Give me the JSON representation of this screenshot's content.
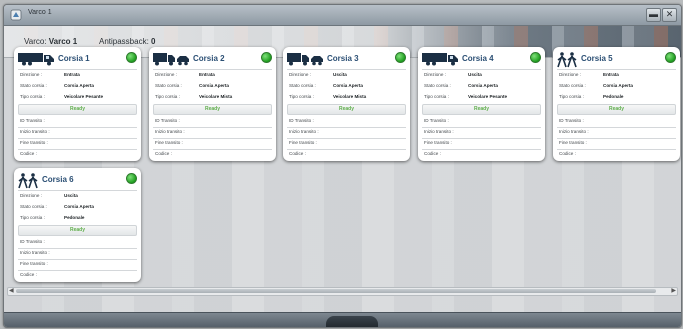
{
  "window": {
    "title": "Varco 1"
  },
  "header": {
    "varco_label": "Varco:",
    "varco_value": "Varco 1",
    "antipass_label": "Antipassback:",
    "antipass_value": "0"
  },
  "labels": {
    "direzione": "Direzione :",
    "stato": "Stato corsia :",
    "tipo": "Tipo corsia :",
    "id": "ID Transito :",
    "inizio": "Inizio transito :",
    "fine": "Fine transito :",
    "codice": "Codice :"
  },
  "lanes": [
    {
      "name": "Corsia 1",
      "icon": "truck-icon",
      "direzione": "Entrata",
      "stato": "Corsia Aperta",
      "tipo": "Veicolare Pesante",
      "status": "Ready",
      "led_color": "#1e9e1e"
    },
    {
      "name": "Corsia 2",
      "icon": "car-truck-icon",
      "direzione": "Entrata",
      "stato": "Corsia Aperta",
      "tipo": "Veicolare Mista",
      "status": "Ready",
      "led_color": "#1e9e1e"
    },
    {
      "name": "Corsia 3",
      "icon": "car-truck-icon",
      "direzione": "Uscita",
      "stato": "Corsia Aperta",
      "tipo": "Veicolare Mista",
      "status": "Ready",
      "led_color": "#1e9e1e"
    },
    {
      "name": "Corsia 4",
      "icon": "truck-icon",
      "direzione": "Uscita",
      "stato": "Corsia Aperta",
      "tipo": "Veicolare Pesante",
      "status": "Ready",
      "led_color": "#1e9e1e"
    },
    {
      "name": "Corsia 5",
      "icon": "pedestrian-icon",
      "direzione": "Entrata",
      "stato": "Corsia Aperta",
      "tipo": "Pedonale",
      "status": "Ready",
      "led_color": "#1e9e1e"
    },
    {
      "name": "Corsia 6",
      "icon": "pedestrian-icon",
      "direzione": "Uscita",
      "stato": "Corsia Aperta",
      "tipo": "Pedonale",
      "status": "Ready",
      "led_color": "#1e9e1e"
    }
  ]
}
